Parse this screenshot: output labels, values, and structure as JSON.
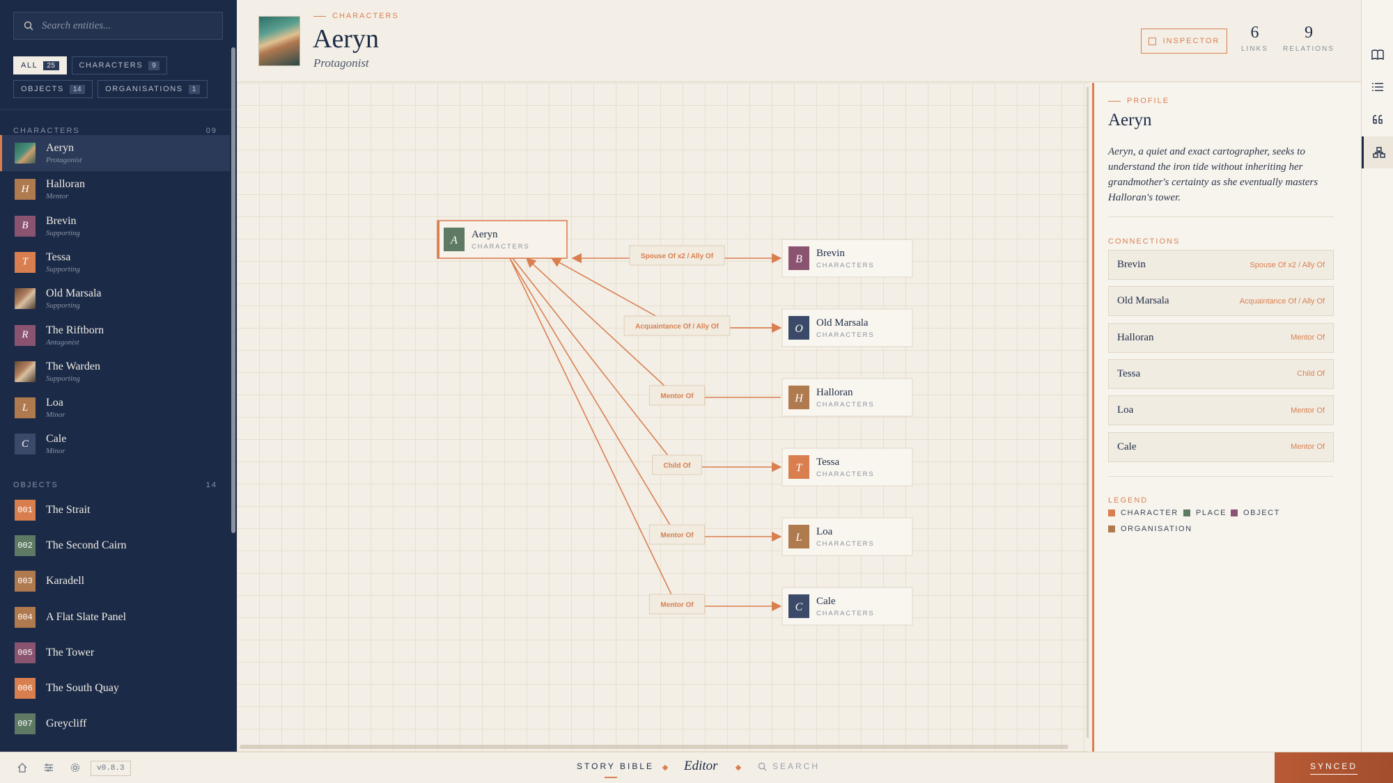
{
  "sidebar": {
    "search_placeholder": "Search entities...",
    "filters": [
      {
        "label": "ALL",
        "count": "25"
      },
      {
        "label": "CHARACTERS",
        "count": "9"
      },
      {
        "label": "OBJECTS",
        "count": "14"
      },
      {
        "label": "ORGANISATIONS",
        "count": "1"
      }
    ],
    "characters_heading": "CHARACTERS",
    "characters_count": "09",
    "characters": [
      {
        "name": "Aeryn",
        "role": "Protagonist",
        "letter": "",
        "color": ""
      },
      {
        "name": "Halloran",
        "role": "Mentor",
        "letter": "H",
        "color": "#b07a4f"
      },
      {
        "name": "Brevin",
        "role": "Supporting",
        "letter": "B",
        "color": "#8a5470"
      },
      {
        "name": "Tessa",
        "role": "Supporting",
        "letter": "T",
        "color": "#d97f4f"
      },
      {
        "name": "Old Marsala",
        "role": "Supporting",
        "letter": "",
        "color": ""
      },
      {
        "name": "The Riftborn",
        "role": "Antagonist",
        "letter": "R",
        "color": "#8a5470"
      },
      {
        "name": "The Warden",
        "role": "Supporting",
        "letter": "",
        "color": ""
      },
      {
        "name": "Loa",
        "role": "Minor",
        "letter": "L",
        "color": "#b07a4f"
      },
      {
        "name": "Cale",
        "role": "Minor",
        "letter": "C",
        "color": "#3b4a68"
      }
    ],
    "objects_heading": "OBJECTS",
    "objects_count": "14",
    "objects": [
      {
        "num": "001",
        "name": "The Strait",
        "color": "#d97f4f"
      },
      {
        "num": "002",
        "name": "The Second Cairn",
        "color": "#5e7a64"
      },
      {
        "num": "003",
        "name": "Karadell",
        "color": "#b07a4f"
      },
      {
        "num": "004",
        "name": "A Flat Slate Panel",
        "color": "#b07a4f"
      },
      {
        "num": "005",
        "name": "The Tower",
        "color": "#8a5470"
      },
      {
        "num": "006",
        "name": "The South Quay",
        "color": "#d97f4f"
      },
      {
        "num": "007",
        "name": "Greycliff",
        "color": "#5e7a64"
      }
    ]
  },
  "header": {
    "eyebrow": "CHARACTERS",
    "title": "Aeryn",
    "subtitle": "Protagonist",
    "inspector_label": "INSPECTOR",
    "links_value": "6",
    "links_label": "LINKS",
    "relations_value": "9",
    "relations_label": "RELATIONS"
  },
  "graph": {
    "center": {
      "name": "Aeryn",
      "type": "CHARACTERS",
      "letter": "A",
      "color": "#5e7a64"
    },
    "nodes": [
      {
        "name": "Brevin",
        "type": "CHARACTERS",
        "letter": "B",
        "color": "#8a5470",
        "relation": "Spouse Of x2 / Ally Of"
      },
      {
        "name": "Old Marsala",
        "type": "CHARACTERS",
        "letter": "O",
        "color": "#3b4a68",
        "relation": "Acquaintance Of / Ally Of"
      },
      {
        "name": "Halloran",
        "type": "CHARACTERS",
        "letter": "H",
        "color": "#b07a4f",
        "relation": "Mentor Of"
      },
      {
        "name": "Tessa",
        "type": "CHARACTERS",
        "letter": "T",
        "color": "#d97f4f",
        "relation": "Child Of"
      },
      {
        "name": "Loa",
        "type": "CHARACTERS",
        "letter": "L",
        "color": "#b07a4f",
        "relation": "Mentor Of"
      },
      {
        "name": "Cale",
        "type": "CHARACTERS",
        "letter": "C",
        "color": "#3b4a68",
        "relation": "Mentor Of"
      }
    ]
  },
  "panel": {
    "eyebrow": "PROFILE",
    "title": "Aeryn",
    "description": "Aeryn, a quiet and exact cartographer, seeks to understand the iron tide without inheriting her grandmother's certainty as she eventually masters Halloran's tower.",
    "connections_label": "CONNECTIONS",
    "connections": [
      {
        "name": "Brevin",
        "relation": "Spouse Of x2 / Ally Of"
      },
      {
        "name": "Old Marsala",
        "relation": "Acquaintance Of / Ally Of"
      },
      {
        "name": "Halloran",
        "relation": "Mentor Of"
      },
      {
        "name": "Tessa",
        "relation": "Child Of"
      },
      {
        "name": "Loa",
        "relation": "Mentor Of"
      },
      {
        "name": "Cale",
        "relation": "Mentor Of"
      }
    ],
    "legend_label": "LEGEND",
    "legend": [
      {
        "label": "CHARACTER",
        "color": "#d97f4f"
      },
      {
        "label": "PLACE",
        "color": "#5e7a64"
      },
      {
        "label": "OBJECT",
        "color": "#8a5470"
      },
      {
        "label": "ORGANISATION",
        "color": "#b07a4f"
      }
    ]
  },
  "footer": {
    "version": "v0.8.3",
    "story_bible": "STORY BIBLE",
    "editor": "Editor",
    "search": "SEARCH",
    "synced": "SYNCED"
  },
  "colors": {
    "accent": "#d97f4f",
    "navy": "#1b2a47"
  }
}
